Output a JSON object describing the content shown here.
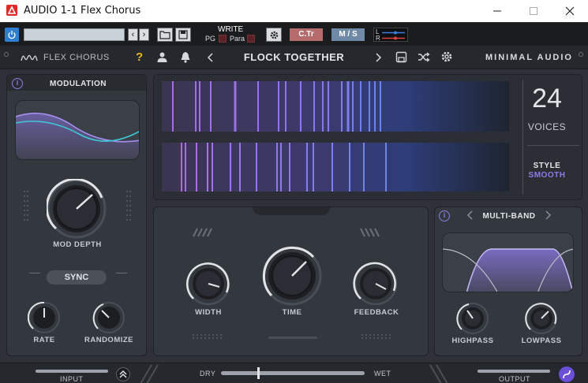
{
  "window": {
    "title": "AUDIO 1-1 Flex Chorus",
    "minimize_icon": "minimize-icon",
    "maximize_icon": "maximize-icon",
    "close_icon": "close-icon"
  },
  "host_toolbar": {
    "preset_value": "",
    "write_label": "WRITE",
    "pg_label": "PG",
    "para_label": "Para",
    "compare_label": "C.Tr",
    "ms_label": "M / S",
    "l_label": "L",
    "r_label": "R"
  },
  "plugin_header": {
    "plugin_name": "FLEX CHORUS",
    "help_icon": "?",
    "preset_name": "FLOCK TOGETHER",
    "brand": "MINIMAL AUDIO"
  },
  "modulation": {
    "title": "MODULATION",
    "mod_depth_label": "MOD DEPTH",
    "sync_label": "SYNC",
    "rate_label": "RATE",
    "randomize_label": "RANDOMIZE"
  },
  "voices_panel": {
    "count": "24",
    "voices_label": "VOICES",
    "style_label": "STYLE",
    "style_value": "SMOOTH"
  },
  "center": {
    "width_label": "WIDTH",
    "time_label": "TIME",
    "feedback_label": "FEEDBACK"
  },
  "filter": {
    "title": "MULTI-BAND",
    "highpass_label": "HIGHPASS",
    "lowpass_label": "LOWPASS"
  },
  "footer": {
    "input_label": "INPUT",
    "dry_label": "DRY",
    "wet_label": "WET",
    "output_label": "OUTPUT"
  },
  "colors": {
    "accent": "#8e7ae8",
    "panel": "#33373e",
    "background": "#2e3137"
  }
}
